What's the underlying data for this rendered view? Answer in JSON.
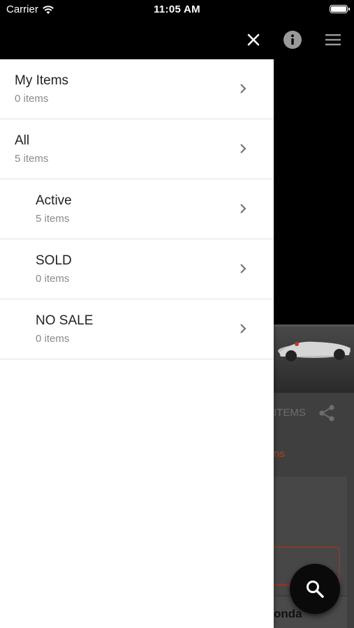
{
  "status_bar": {
    "carrier": "Carrier",
    "time": "11:05 AM"
  },
  "drawer": {
    "items": [
      {
        "title": "My Items",
        "subtitle": "0 items"
      },
      {
        "title": "All",
        "subtitle": "5 items"
      },
      {
        "title": "Active",
        "subtitle": "5 items"
      },
      {
        "title": "SOLD",
        "subtitle": "0 items"
      },
      {
        "title": "NO SALE",
        "subtitle": "0 items"
      }
    ]
  },
  "background": {
    "items_tab_partial": "ITEMS",
    "orange_partial": "ns",
    "card_title_partial": "onda"
  },
  "colors": {
    "accent": "#9a4a2a",
    "drawer_bg": "#ffffff",
    "header_bg": "#000000"
  },
  "icons": {
    "close": "close-icon",
    "info": "info-icon",
    "menu": "hamburger-menu-icon",
    "share": "share-icon",
    "search": "search-icon",
    "chevron": "chevron-right-icon"
  }
}
